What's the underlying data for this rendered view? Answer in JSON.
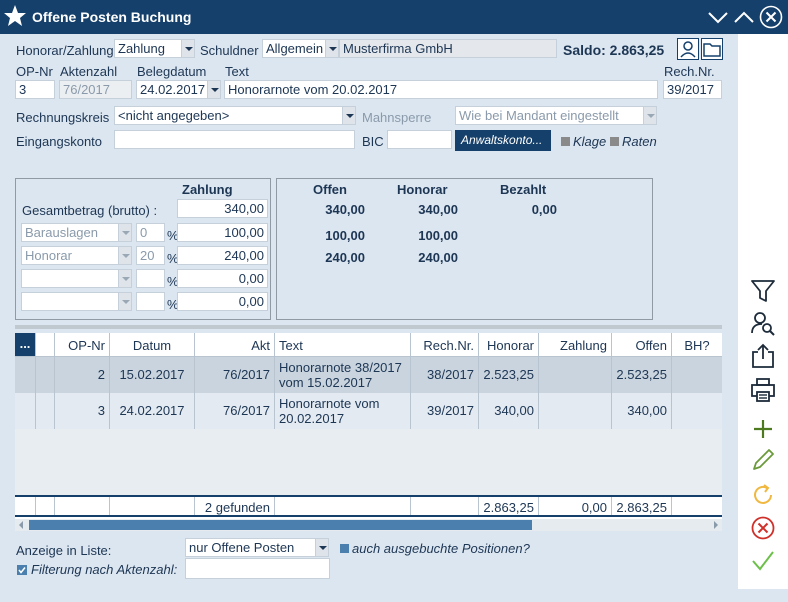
{
  "window": {
    "title": "Offene Posten Buchung"
  },
  "header": {
    "honorar_label": "Honorar/Zahlung",
    "honorar_value": "Zahlung",
    "schuldner_label": "Schuldner",
    "schuldner_value": "Allgemein",
    "schuldner_name": "Musterfirma GmbH",
    "saldo": "Saldo: 2.863,25",
    "op_nr_label": "OP-Nr",
    "op_nr_value": "3",
    "aktenzahl_label": "Aktenzahl",
    "aktenzahl_value": "76/2017",
    "belegdatum_label": "Belegdatum",
    "belegdatum_value": "24.02.2017",
    "text_label": "Text",
    "text_value": "Honorarnote vom 20.02.2017",
    "rechnr_label": "Rech.Nr.",
    "rechnr_value": "39/2017",
    "rechnungskreis_label": "Rechnungskreis",
    "rechnungskreis_value": "<nicht angegeben>",
    "mahnsperre_label": "Mahnsperre",
    "mahnsperre_value": "Wie bei Mandant eingestellt",
    "eingangskonto_label": "Eingangskonto",
    "eingangskonto_value": "",
    "bic_label": "BIC",
    "bic_value": "",
    "anwaltskonto_button": "Anwaltskonto...",
    "klage_label": "Klage",
    "raten_label": "Raten"
  },
  "payment": {
    "zahlung_header": "Zahlung",
    "gesamtbetrag_label": "Gesamtbetrag (brutto) :",
    "gesamtbetrag_value": "340,00",
    "rows": [
      {
        "type": "Barauslagen",
        "pct": "0",
        "pct_sign": "%",
        "amount": "100,00"
      },
      {
        "type": "Honorar",
        "pct": "20",
        "pct_sign": "%",
        "amount": "240,00"
      },
      {
        "type": "",
        "pct": "",
        "pct_sign": "%",
        "amount": "0,00"
      },
      {
        "type": "",
        "pct": "",
        "pct_sign": "%",
        "amount": "0,00"
      }
    ]
  },
  "summary": {
    "headers": {
      "offen": "Offen",
      "honorar": "Honorar",
      "bezahlt": "Bezahlt"
    },
    "rows": [
      {
        "offen": "340,00",
        "honorar": "340,00",
        "bezahlt": "0,00"
      },
      {
        "offen": "100,00",
        "honorar": "100,00",
        "bezahlt": ""
      },
      {
        "offen": "240,00",
        "honorar": "240,00",
        "bezahlt": ""
      }
    ]
  },
  "grid": {
    "dots": "...",
    "columns": [
      "OP-Nr",
      "Datum",
      "Akt",
      "Text",
      "Rech.Nr.",
      "Honorar",
      "Zahlung",
      "Offen",
      "BH?"
    ],
    "rows": [
      {
        "op_nr": "2",
        "datum": "15.02.2017",
        "akt": "76/2017",
        "text": "Honorarnote 38/2017 vom 15.02.2017",
        "rechnr": "38/2017",
        "honorar": "2.523,25",
        "zahlung": "",
        "offen": "2.523,25",
        "bh": ""
      },
      {
        "op_nr": "3",
        "datum": "24.02.2017",
        "akt": "76/2017",
        "text": "Honorarnote vom 20.02.2017",
        "rechnr": "39/2017",
        "honorar": "340,00",
        "zahlung": "",
        "offen": "340,00",
        "bh": ""
      }
    ],
    "footer": {
      "count": "2 gefunden",
      "honorar": "2.863,25",
      "zahlung": "0,00",
      "offen": "2.863,25"
    }
  },
  "bottom": {
    "anzeige_label": "Anzeige in Liste:",
    "anzeige_value": "nur Offene Posten",
    "ausgebucht_label": "auch ausgebuchte Positionen?",
    "filter_label": "Filterung nach Aktenzahl:",
    "filter_value": ""
  },
  "colors": {
    "titlebar": "#15406b",
    "accent": "#4a7fae",
    "background": "#dce6f0"
  },
  "icons": [
    "star-icon",
    "minimize-icon",
    "maximize-icon",
    "close-icon",
    "person-icon",
    "folder-icon",
    "filter-icon",
    "user-search-icon",
    "share-icon",
    "print-icon",
    "add-icon",
    "edit-icon",
    "refresh-icon",
    "cancel-icon",
    "confirm-icon"
  ]
}
